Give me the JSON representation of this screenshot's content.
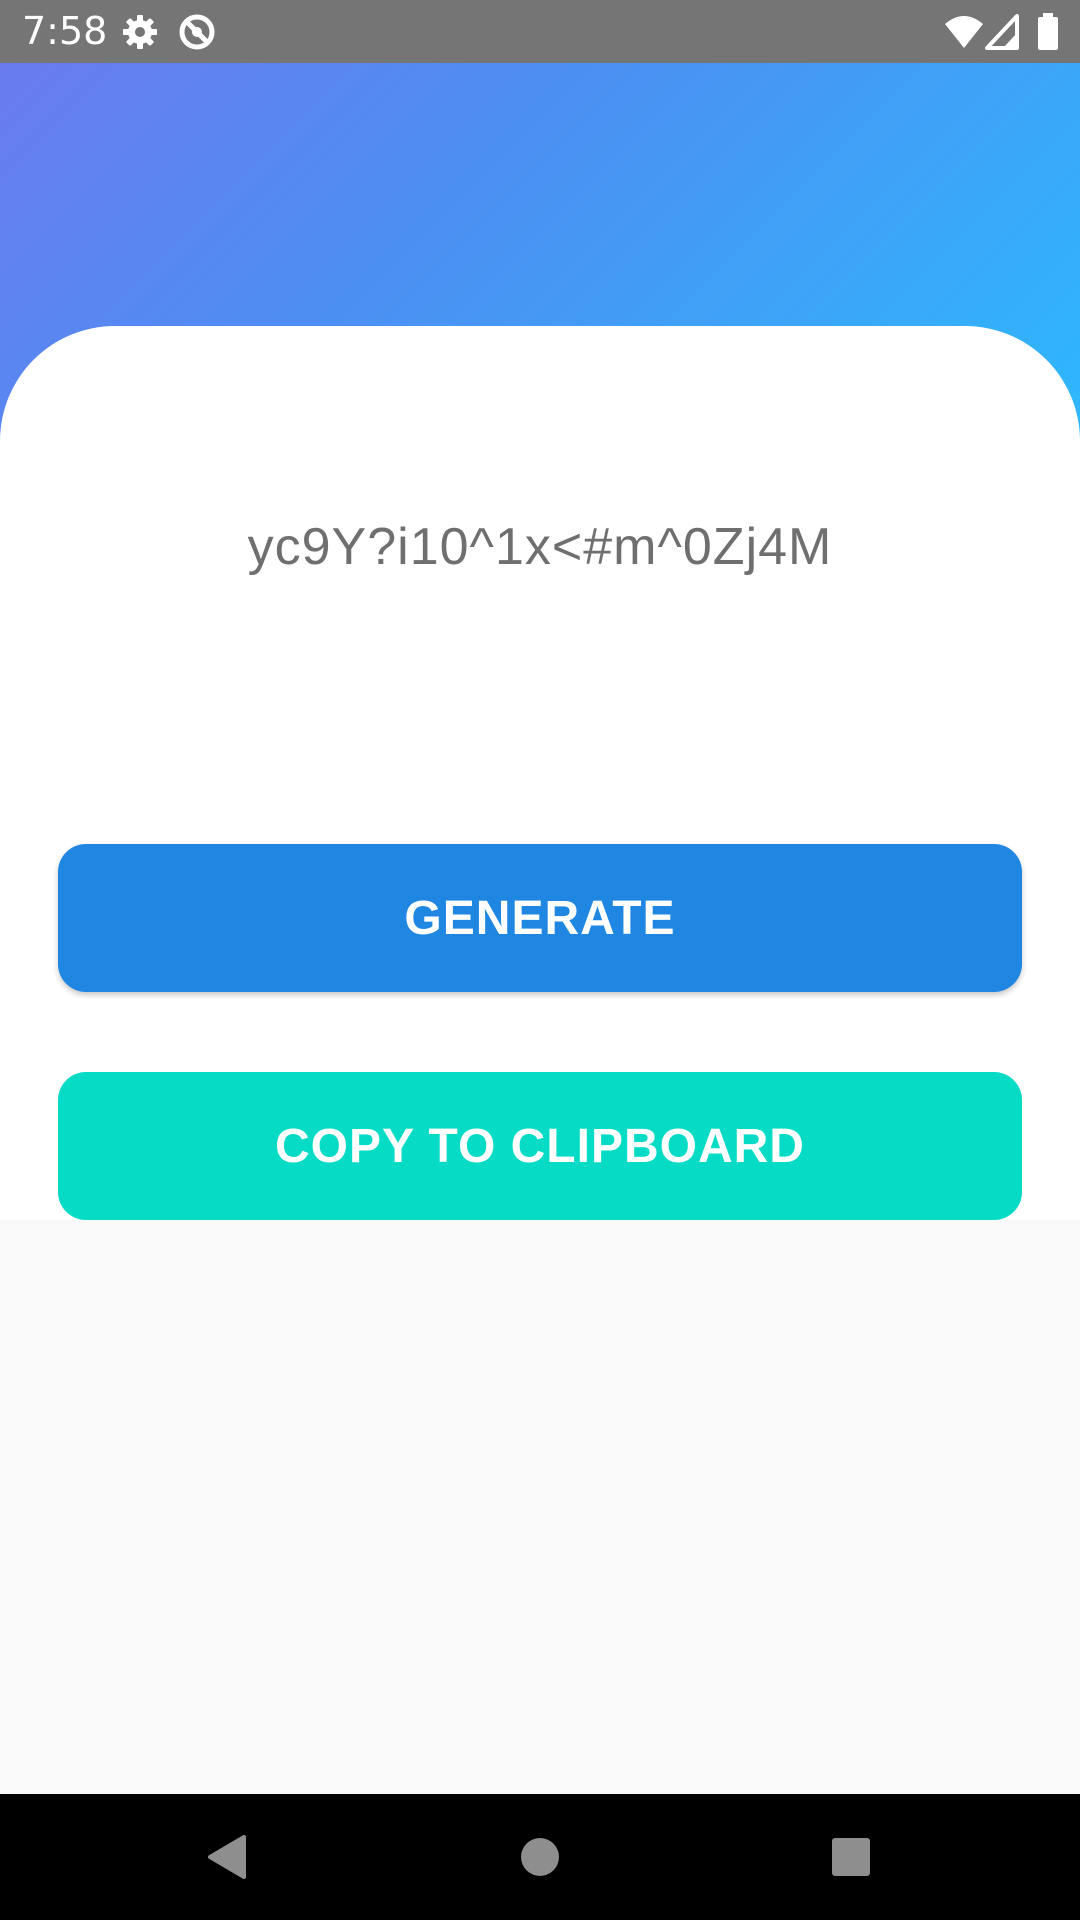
{
  "status_bar": {
    "time": "7:58",
    "icons": [
      "gear-icon",
      "sync-icon",
      "wifi-icon",
      "signal-icon",
      "battery-icon"
    ]
  },
  "colors": {
    "status_bar": "#757575",
    "gradient_start": "#6a7bf0",
    "gradient_end": "#2db9fd",
    "generate_button": "#1f86e2",
    "copy_button": "#05dbc5",
    "password_text": "#6f6f6f",
    "nav_bar": "#000000"
  },
  "main": {
    "password": "yc9Y?i10^1x<#m^0Zj4M",
    "generate_label": "GENERATE",
    "copy_label": "COPY TO CLIPBOARD"
  },
  "nav_bar": {
    "icons": [
      "back-icon",
      "home-icon",
      "recents-icon"
    ]
  }
}
